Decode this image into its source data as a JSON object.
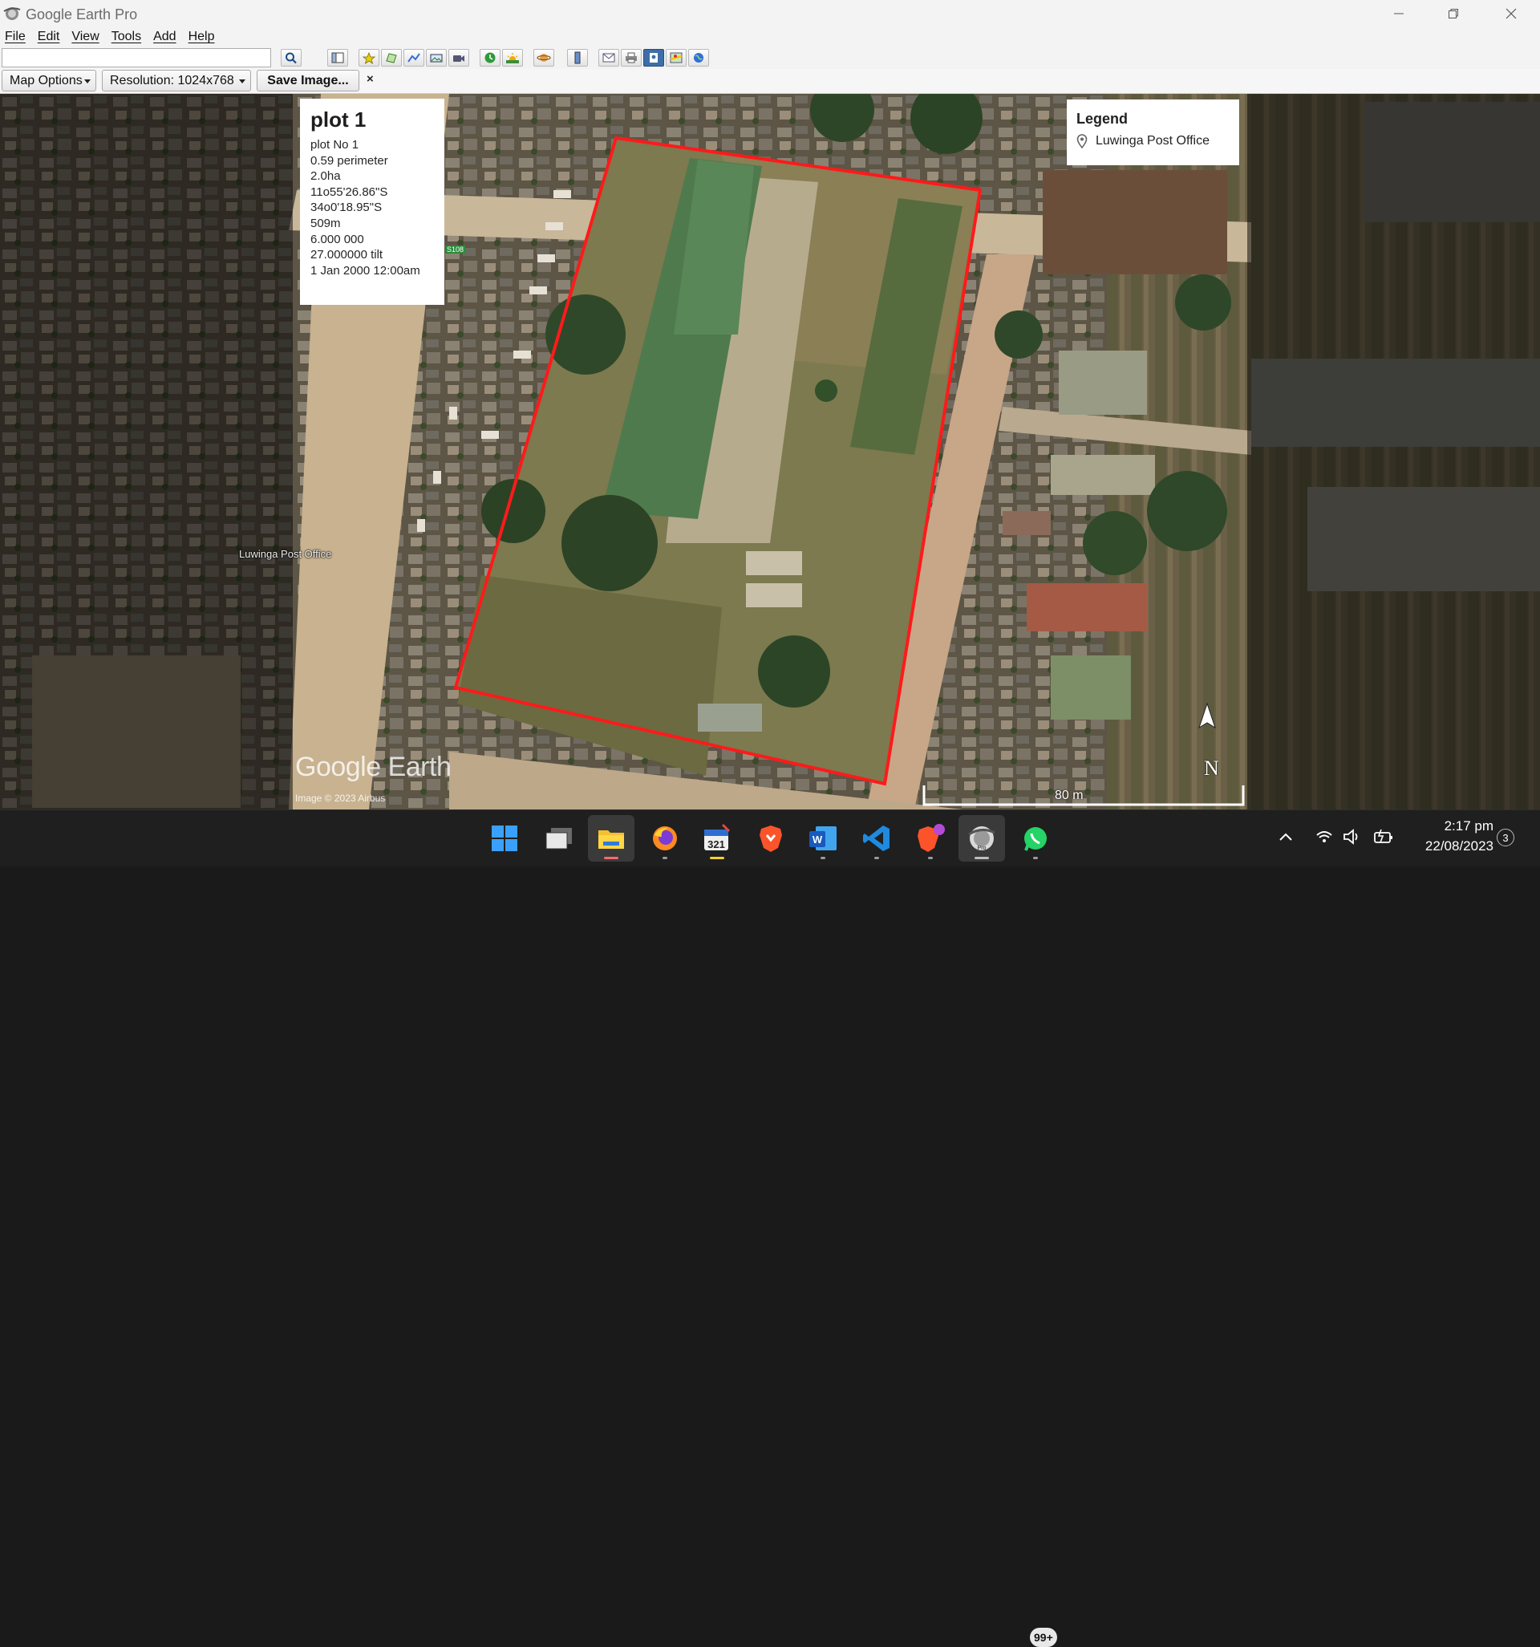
{
  "window": {
    "title": "Google Earth Pro",
    "minimize_icon": "minimize-icon",
    "restore_icon": "restore-icon",
    "close_icon": "close-icon"
  },
  "menu": [
    "File",
    "Edit",
    "View",
    "Tools",
    "Add",
    "Help"
  ],
  "toolbar": {
    "search_value": "",
    "icons": [
      "search-icon",
      "sidebar-icon",
      "placemark-icon",
      "polygon-icon",
      "path-icon",
      "image-overlay-icon",
      "record-tour-icon",
      "historical-imagery-icon",
      "sunlight-icon",
      "planets-icon",
      "ruler-icon",
      "email-icon",
      "print-icon",
      "save-image-icon",
      "google-maps-icon",
      "earth-gallery-icon"
    ]
  },
  "print_panel": {
    "map_options": "Map Options",
    "resolution": "Resolution: 1024x768",
    "save_image": "Save Image...",
    "close": "×"
  },
  "info_card": {
    "title": "plot 1",
    "lines": [
      "plot No 1",
      "0.59 perimeter",
      "2.0ha",
      "11o55'26.86\"S",
      "34o0'18.95\"S",
      "509m",
      "6.000 000",
      "27.000000 tilt",
      "1 Jan 2000 12:00am"
    ]
  },
  "legend": {
    "title": "Legend",
    "item": "Luwinga Post Office"
  },
  "map": {
    "place_label": "Luwinga Post Office",
    "road_sign": "S108",
    "watermark": "Google Earth",
    "imagery_credit": "Image © 2023 Airbus",
    "scale_label": "80 m",
    "north_label": "N",
    "plot_outline_color": "#ff1a1a"
  },
  "taskbar": {
    "apps": [
      "windows-start-icon",
      "task-view-icon",
      "file-explorer-icon",
      "firefox-icon",
      "calendar-app-icon",
      "brave-icon",
      "word-icon",
      "vscode-icon",
      "brave-beta-icon",
      "google-earth-pro-icon",
      "whatsapp-icon"
    ],
    "whatsapp_badge": "99+",
    "time": "2:17 pm",
    "date": "22/08/2023",
    "notifications": "3"
  }
}
